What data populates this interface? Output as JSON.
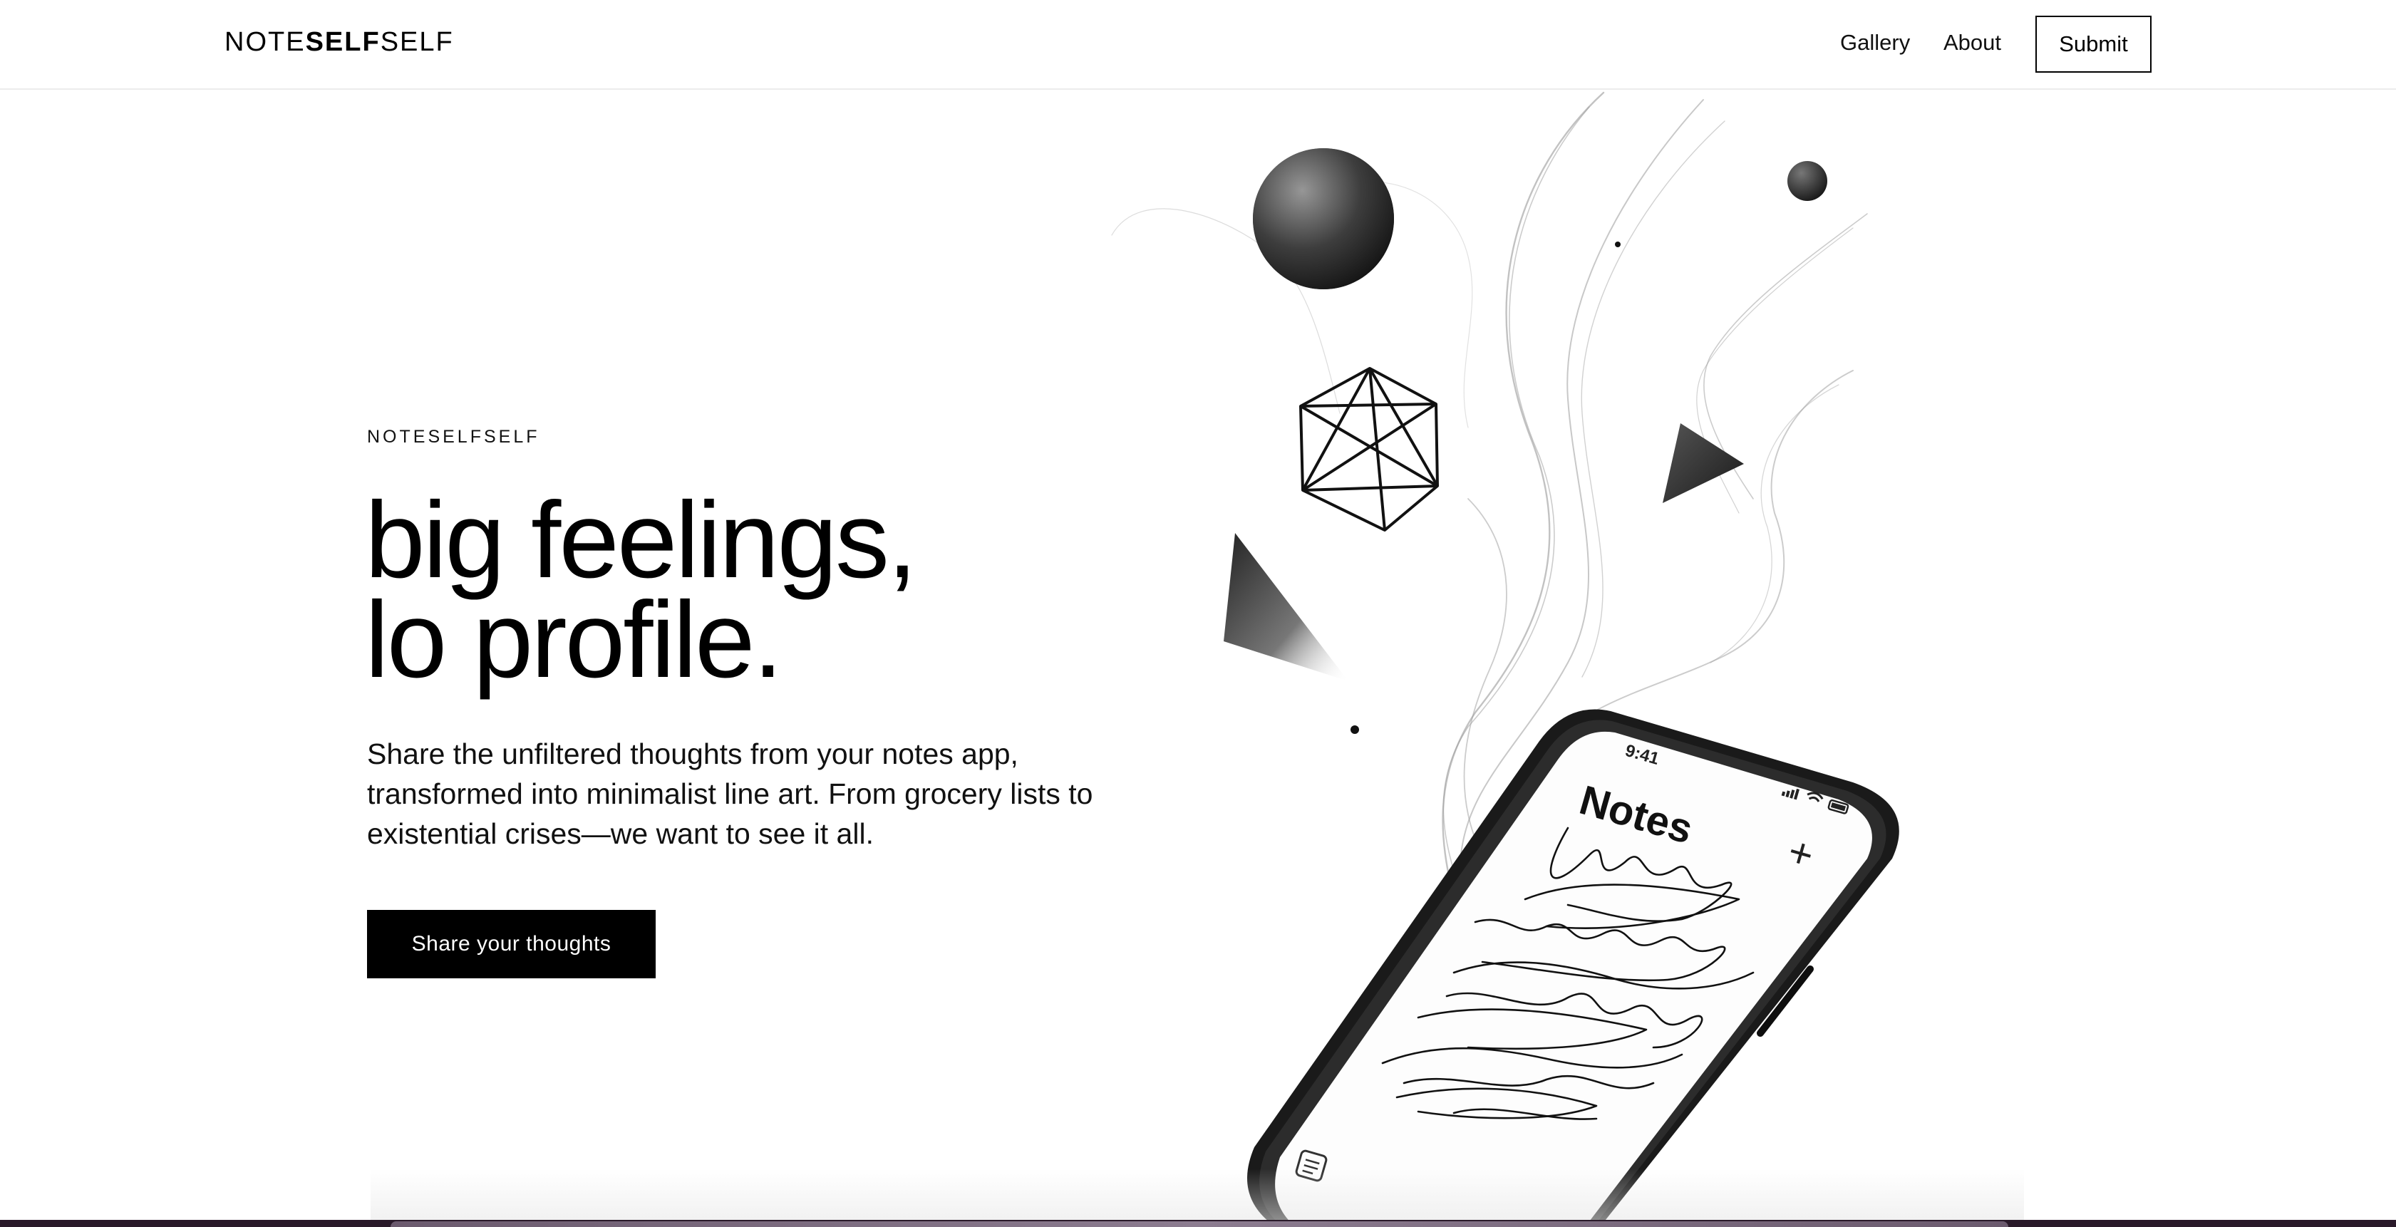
{
  "header": {
    "logo_prefix": "NOTE",
    "logo_bold": "SELF",
    "logo_suffix": "SELF",
    "nav": {
      "gallery": "Gallery",
      "about": "About"
    },
    "submit_label": "Submit"
  },
  "hero": {
    "eyebrow": "NOTESELFSELF",
    "headline_line1": "big feelings,",
    "headline_line2": "lo profile.",
    "description": "Share the unfiltered thoughts from your notes app, transformed into minimalist line art. From grocery lists to existential crises—we want to see it all.",
    "cta_label": "Share your thoughts"
  },
  "illustration": {
    "phone_time": "9:41",
    "phone_app_title": "Notes",
    "phone_add_symbol": "+",
    "icons": {
      "add": "plus-icon",
      "compose": "note-icon",
      "signal": "signal-icon",
      "wifi": "wifi-icon",
      "battery": "battery-icon"
    }
  },
  "colors": {
    "background": "#ffffff",
    "text": "#000000",
    "accent": "#000000",
    "bottom_band": "#2a1a2a"
  }
}
